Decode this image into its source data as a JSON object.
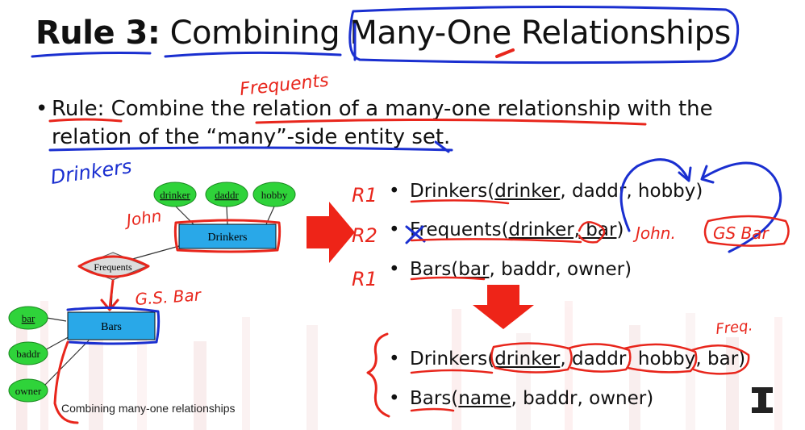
{
  "slide": {
    "title_bold": "Rule 3:",
    "title_rest": "Combining Many-One Relationships",
    "rule_line1_a": "Rule: ",
    "rule_line1_b": "Combine the relation of a many-one relationship with the",
    "rule_line2": "relation of the “many”-side entity set.",
    "caption": "Combining many-one relationships"
  },
  "diagram": {
    "entity_drinkers": "Drinkers",
    "entity_bars": "Bars",
    "relationship": "Frequents",
    "drinker_attrs": [
      "drinker",
      "daddr",
      "hobby"
    ],
    "bar_attrs": [
      "bar",
      "baddr",
      "owner"
    ]
  },
  "relations_before": [
    {
      "name": "Drinkers(",
      "key": "drinker",
      "rest": ", daddr, hobby)"
    },
    {
      "name": "Frequents(",
      "key": "drinker, bar",
      "rest": ")"
    },
    {
      "name": "Bars(",
      "key": "bar",
      "rest": ", baddr, owner)"
    }
  ],
  "relations_after": [
    {
      "name": "Drinkers(",
      "key": "drinker",
      "rest": ", daddr, hobby, bar)"
    },
    {
      "name": "Bars(",
      "key": "name",
      "rest": ", baddr, owner)"
    }
  ],
  "annotations": {
    "frequents_above": "Frequents",
    "drinkers_note": "Drinkers",
    "john_diagram": "John",
    "gsbar_diagram": "G.S. Bar",
    "r1": "R1",
    "r2": "R2",
    "r1b": "R1",
    "john_right": "John.",
    "gsbar_right": "GS Bar",
    "freq": "Freq."
  },
  "colors": {
    "ink_red": "#e8261c",
    "ink_blue": "#1a2fd0",
    "entity_fill": "#29a8e8",
    "attr_fill": "#2fd33a",
    "arrow_red": "#ee2418"
  }
}
